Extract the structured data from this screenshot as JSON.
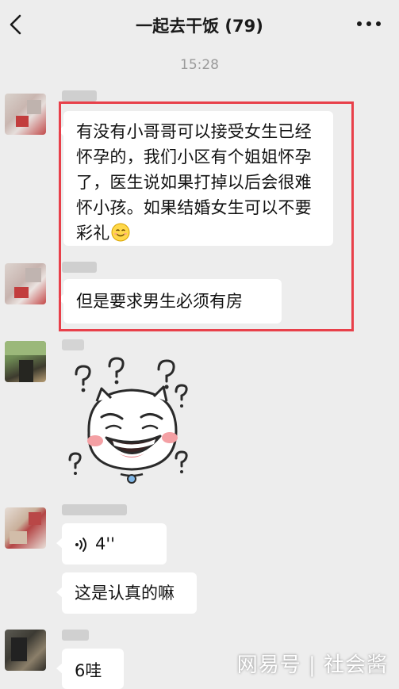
{
  "header": {
    "title": "一起去干饭 (79)",
    "back_icon": "chevron-left-icon",
    "more_icon": "more-dots-icon"
  },
  "timestamp": "15:28",
  "messages": [
    {
      "type": "text",
      "text": "有没有小哥哥可以接受女生已经怀孕的，我们小区有个姐姐怀孕了，医生说如果打掉以后会很难怀小孩。如果结婚女生可以不要彩礼",
      "emoji": "smile-emoji"
    },
    {
      "type": "text",
      "text": "但是要求男生必须有房"
    },
    {
      "type": "sticker",
      "icon": "confused-laughing-sticker"
    },
    {
      "type": "voice",
      "duration": "4''"
    },
    {
      "type": "text",
      "text": "这是认真的嘛"
    },
    {
      "type": "text",
      "text": "6哇"
    }
  ],
  "watermark": "网易号 | 社会酱",
  "colors": {
    "background": "#ededed",
    "bubble": "#ffffff",
    "highlight": "#e8404a"
  }
}
